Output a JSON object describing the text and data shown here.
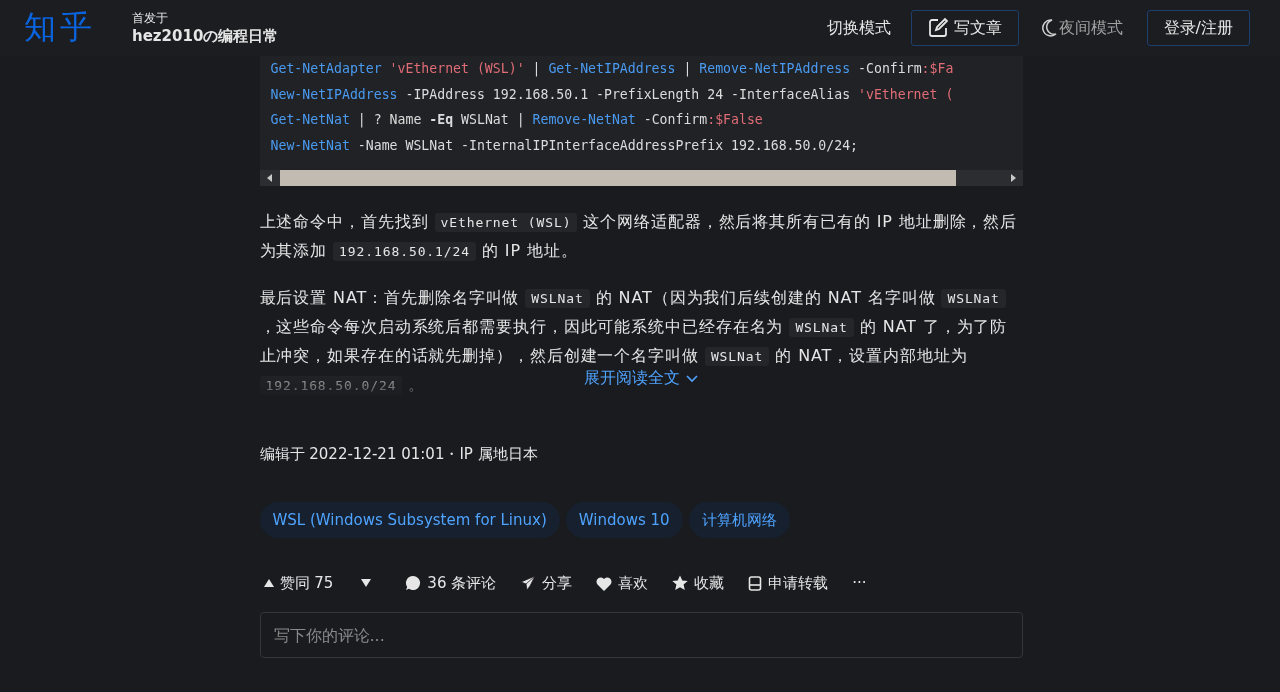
{
  "header": {
    "logo": "知乎",
    "column_label": "首发于",
    "column_name": "hez2010の编程日常",
    "switch_mode": "切换模式",
    "write_button": "写文章",
    "night_mode": "夜间模式",
    "login_button": "登录/注册"
  },
  "code_lines": [
    [
      {
        "kind": "cmd",
        "text": "Get-NetAdapter "
      },
      {
        "kind": "str",
        "text": "'vEthernet (WSL)'"
      },
      {
        "kind": "plain",
        "text": " | "
      },
      {
        "kind": "cmd",
        "text": "Get-NetIPAddress"
      },
      {
        "kind": "plain",
        "text": " | "
      },
      {
        "kind": "cmd",
        "text": "Remove-NetIPAddress"
      },
      {
        "kind": "plain",
        "text": " -Confirm"
      },
      {
        "kind": "var",
        "text": ":$Fa"
      }
    ],
    [
      {
        "kind": "cmd",
        "text": "New-NetIPAddress"
      },
      {
        "kind": "plain",
        "text": " -IPAddress 192.168.50.1 -PrefixLength 24 -InterfaceAlias "
      },
      {
        "kind": "str",
        "text": "'vEthernet ("
      }
    ],
    [
      {
        "kind": "cmd",
        "text": "Get-NetNat"
      },
      {
        "kind": "plain",
        "text": " | ? Name "
      },
      {
        "kind": "bold",
        "text": "-Eq"
      },
      {
        "kind": "plain",
        "text": " WSLNat | "
      },
      {
        "kind": "cmd",
        "text": "Remove-NetNat"
      },
      {
        "kind": "plain",
        "text": " -Confirm"
      },
      {
        "kind": "var",
        "text": ":$False"
      }
    ],
    [
      {
        "kind": "cmd",
        "text": "New-NetNat"
      },
      {
        "kind": "plain",
        "text": " -Name WSLNat -InternalIPInterfaceAddressPrefix 192.168.50.0/24;"
      }
    ]
  ],
  "paragraphs": [
    [
      {
        "kind": "text",
        "text": "上述命令中，首先找到 "
      },
      {
        "kind": "code",
        "text": "vEthernet (WSL)"
      },
      {
        "kind": "text",
        "text": " 这个网络适配器，然后将其所有已有的 IP 地址删除，然后为其添加 "
      },
      {
        "kind": "code",
        "text": "192.168.50.1/24"
      },
      {
        "kind": "text",
        "text": " 的 IP 地址。"
      }
    ],
    [
      {
        "kind": "text",
        "text": "最后设置 NAT：首先删除名字叫做 "
      },
      {
        "kind": "code",
        "text": "WSLNat"
      },
      {
        "kind": "text",
        "text": " 的 NAT（因为我们后续创建的 NAT 名字叫做 "
      },
      {
        "kind": "code",
        "text": "WSLNat"
      },
      {
        "kind": "text",
        "text": " ，这些命令每次启动系统后都需要执行，因此可能系统中已经存在名为 "
      },
      {
        "kind": "code",
        "text": "WSLNat"
      },
      {
        "kind": "text",
        "text": " 的 NAT 了，为了防止冲突，如果存在的话就先删掉），然后创建一个名字叫做 "
      },
      {
        "kind": "code",
        "text": "WSLNat"
      },
      {
        "kind": "text",
        "text": " 的 NAT，设置内部地址为 "
      },
      {
        "kind": "code",
        "text": "192.168.50.0/24"
      },
      {
        "kind": "text",
        "text": " 。"
      }
    ]
  ],
  "expand_link": "展开阅读全文",
  "edited": "编辑于 2022-12-21 01:01・IP 属地日本",
  "tags": [
    "WSL (Windows Subsystem for Linux)",
    "Windows 10",
    "计算机网络"
  ],
  "actions": [
    {
      "kind": "upvote",
      "label": "赞同 75"
    },
    {
      "kind": "downvote"
    },
    {
      "kind": "comment",
      "label": "36 条评论"
    },
    {
      "kind": "share",
      "label": "分享"
    },
    {
      "kind": "like",
      "label": "喜欢"
    },
    {
      "kind": "favorite",
      "label": "收藏"
    },
    {
      "kind": "repost",
      "label": "申请转载"
    },
    {
      "kind": "more",
      "label": "···"
    }
  ],
  "comment_box": {
    "placeholder": "写下你的评论..."
  }
}
